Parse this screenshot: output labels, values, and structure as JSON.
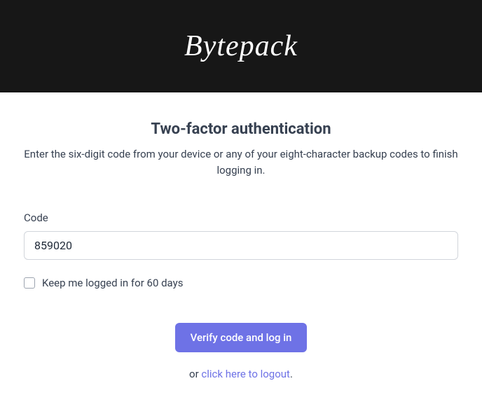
{
  "header": {
    "brand": "Bytepack"
  },
  "page": {
    "title": "Two-factor authentication",
    "subtitle": "Enter the six-digit code from your device or any of your eight-character backup codes to finish logging in."
  },
  "form": {
    "code_label": "Code",
    "code_value": "859020",
    "remember_label": "Keep me logged in for 60 days",
    "submit_label": "Verify code and log in"
  },
  "footer": {
    "or_text": "or ",
    "logout_link": "click here to logout",
    "period": "."
  }
}
